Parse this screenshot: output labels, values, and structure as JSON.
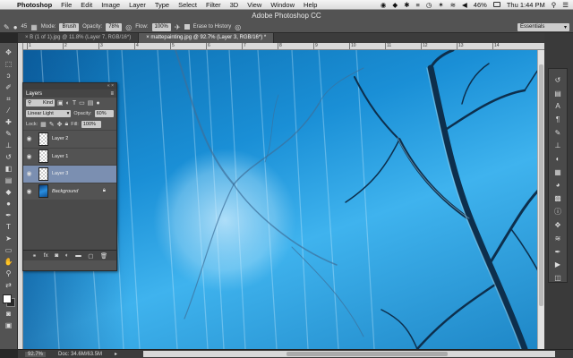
{
  "menubar": {
    "app": "Photoshop",
    "items": [
      "File",
      "Edit",
      "Image",
      "Layer",
      "Type",
      "Select",
      "Filter",
      "3D",
      "View",
      "Window",
      "Help"
    ],
    "battery": "46%",
    "clock": "Thu 1:44 PM"
  },
  "options": {
    "app_title": "Adobe Photoshop CC",
    "brush_size": "45",
    "mode_label": "Mode:",
    "mode_value": "Brush",
    "opacity_label": "Opacity:",
    "opacity_value": "78%",
    "flow_label": "Flow:",
    "flow_value": "100%",
    "erase_history_label": "Erase to History",
    "workspace": "Essentials"
  },
  "tabs": [
    {
      "label": "B (1 of 1).jpg @ 11.8% (Layer 7, RGB/16*)",
      "active": false
    },
    {
      "label": "mattepainting.jpg @ 92.7% (Layer 3, RGB/16*) *",
      "active": true
    }
  ],
  "ruler": {
    "ticks": [
      "1",
      "2",
      "3",
      "4",
      "5",
      "6",
      "7",
      "8",
      "9",
      "10",
      "11",
      "12",
      "13",
      "14"
    ]
  },
  "layers_panel": {
    "title": "Layers",
    "kind_label": "Kind",
    "blend_mode": "Linear Light",
    "opacity_label": "Opacity:",
    "opacity_value": "60%",
    "lock_label": "Lock:",
    "fill_label": "Fill:",
    "fill_value": "100%",
    "layers": [
      {
        "name": "Layer 2",
        "selected": false,
        "locked": false
      },
      {
        "name": "Layer 1",
        "selected": false,
        "locked": false
      },
      {
        "name": "Layer 3",
        "selected": true,
        "locked": false
      },
      {
        "name": "Background",
        "selected": false,
        "locked": true
      }
    ]
  },
  "status": {
    "zoom": "92.7%",
    "doc": "Doc: 34.6M/63.5M"
  },
  "colors": {
    "ui_dark": "#535353",
    "selection": "#7b8fb1",
    "canvas_blue": "#1a8fd6"
  }
}
